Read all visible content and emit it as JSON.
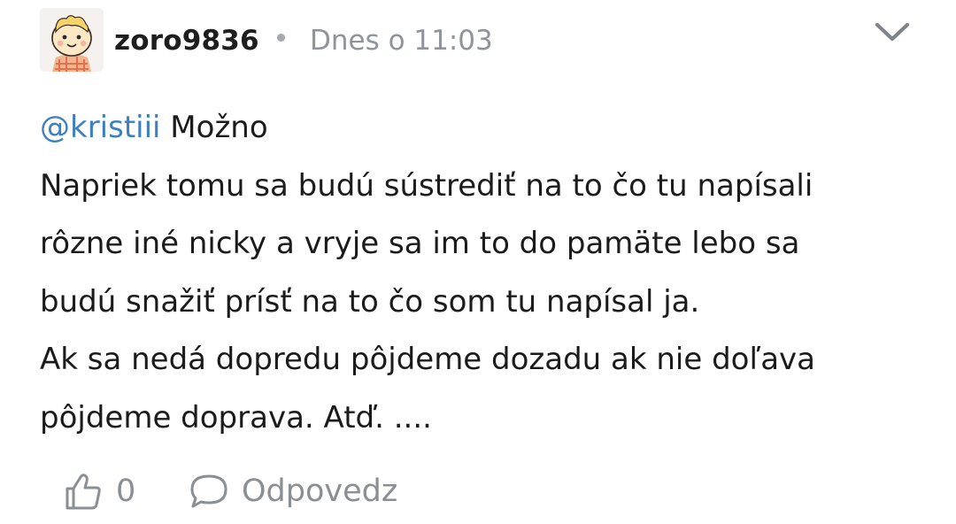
{
  "comment": {
    "author": "zoro9836",
    "timestamp": "Dnes o 11:03",
    "mention": "@kristiii",
    "first_line_rest": " Možno",
    "lines": [
      "Napriek tomu sa budú sústrediť na to čo tu napísali",
      "rôzne iné nicky a vryje sa im to do pamäte lebo sa",
      "budú snažiť prísť na to čo som tu napísal ja.",
      "Ak sa nedá dopredu pôjdeme dozadu ak nie doľava",
      "pôjdeme doprava. Atď. ...."
    ],
    "likes": "0",
    "reply_label": "Odpovedz"
  },
  "icons": {
    "avatar": "cartoon-avatar",
    "menu": "chevron-down-icon",
    "like": "thumbs-up-icon",
    "reply": "speech-bubble-icon"
  },
  "colors": {
    "mention": "#3d7fc1",
    "meta": "#8f949b",
    "text": "#1b1b1b"
  }
}
